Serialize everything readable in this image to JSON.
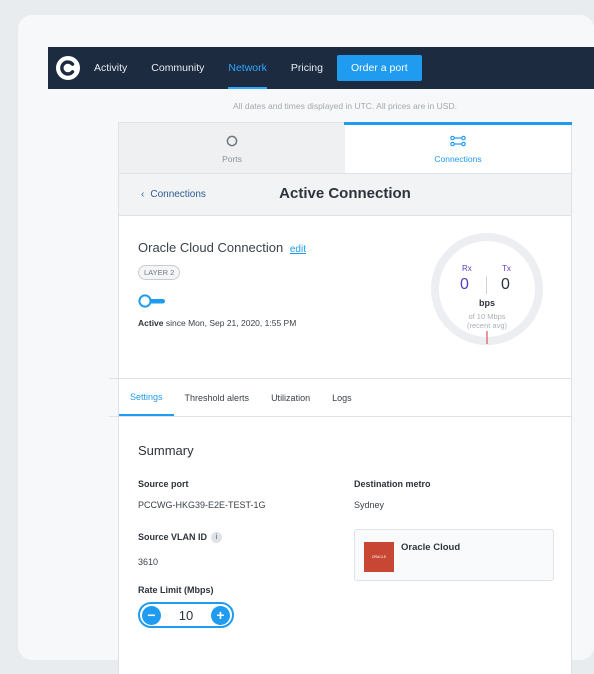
{
  "nav": {
    "items": [
      {
        "label": "Activity"
      },
      {
        "label": "Community"
      },
      {
        "label": "Network"
      },
      {
        "label": "Pricing"
      }
    ],
    "cta": "Order a port",
    "active": "Network"
  },
  "notice": "All dates and times displayed in UTC. All prices are in USD.",
  "top_tabs": [
    {
      "label": "Ports",
      "icon": "circle-icon"
    },
    {
      "label": "Connections",
      "icon": "connections-icon"
    }
  ],
  "subheader": {
    "back_label": "Connections",
    "title": "Active Connection"
  },
  "connection": {
    "name": "Oracle Cloud Connection",
    "edit_label": "edit",
    "badge": "LAYER 2",
    "status_bold": "Active",
    "status_rest": " since Mon, Sep 21, 2020, 1:55 PM"
  },
  "gauge": {
    "rx_label": "Rx",
    "tx_label": "Tx",
    "rx_value": "0",
    "tx_value": "0",
    "unit": "bps",
    "of_line1": "of 10 Mbps",
    "of_line2": "(recent avg)"
  },
  "settings_tabs": [
    {
      "label": "Settings"
    },
    {
      "label": "Threshold alerts"
    },
    {
      "label": "Utilization"
    },
    {
      "label": "Logs"
    }
  ],
  "summary": {
    "title": "Summary",
    "source_port_label": "Source port",
    "source_port_value": "PCCWG-HKG39-E2E-TEST-1G",
    "dest_metro_label": "Destination metro",
    "dest_metro_value": "Sydney",
    "vlan_label": "Source VLAN ID",
    "vlan_value": "3610",
    "provider_name": "Oracle Cloud",
    "provider_logo_text": "ORACLE",
    "rate_label": "Rate Limit (Mbps)",
    "rate_value": "10"
  },
  "colors": {
    "nav_bg": "#1c2b3f",
    "accent": "#1f9bf0",
    "oracle_red": "#c74634"
  }
}
